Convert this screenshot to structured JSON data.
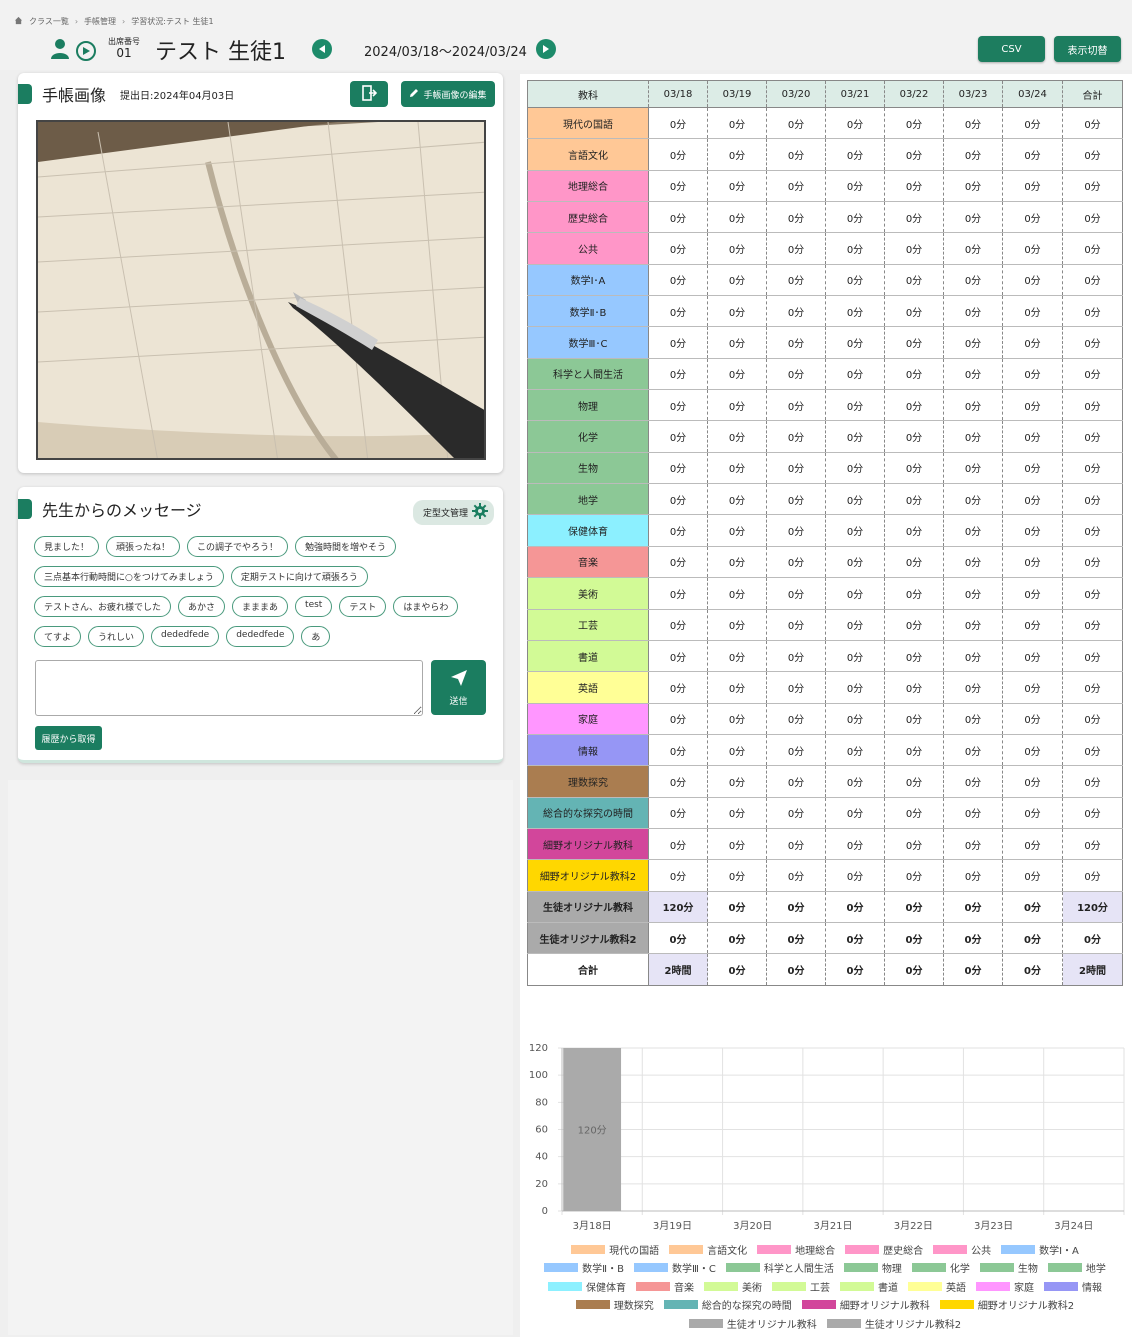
{
  "breadcrumb": [
    "クラス一覧",
    "手帳管理",
    "学習状況:テスト 生徒1"
  ],
  "header": {
    "seat_label": "出席番号",
    "seat_number": "01",
    "student_name": "テスト 生徒1",
    "date_range": "2024/03/18〜2024/03/24",
    "csv_label": "CSV",
    "toggle_label": "表示切替"
  },
  "notebook": {
    "title": "手帳画像",
    "submit_date": "提出日:2024年04月03日",
    "edit_label": "手帳画像の編集"
  },
  "message": {
    "title": "先生からのメッセージ",
    "template_label": "定型文管理",
    "chips": [
      [
        "見ました！",
        "頑張ったね！",
        "この調子でやろう！",
        "勉強時間を増やそう"
      ],
      [
        "三点基本行動時間に○をつけてみましょう",
        "定期テストに向けて頑張ろう"
      ],
      [
        "テストさん、お疲れ様でした",
        "あかさ",
        "まままあ",
        "test",
        "テスト",
        "はまやらわ"
      ],
      [
        "てすよ",
        "うれしい",
        "dededfede",
        "dededfede",
        "あ"
      ]
    ],
    "textarea_value": "",
    "send_label": "送信",
    "history_label": "履歴から取得"
  },
  "table": {
    "headers": [
      "教科",
      "03/18",
      "03/19",
      "03/20",
      "03/21",
      "03/22",
      "03/23",
      "03/24",
      "合計"
    ],
    "rows": [
      {
        "subject": "現代の国語",
        "color": "#ffc896",
        "values": [
          "0分",
          "0分",
          "0分",
          "0分",
          "0分",
          "0分",
          "0分",
          "0分"
        ]
      },
      {
        "subject": "言語文化",
        "color": "#ffc896",
        "values": [
          "0分",
          "0分",
          "0分",
          "0分",
          "0分",
          "0分",
          "0分",
          "0分"
        ]
      },
      {
        "subject": "地理総合",
        "color": "#ff96c8",
        "values": [
          "0分",
          "0分",
          "0分",
          "0分",
          "0分",
          "0分",
          "0分",
          "0分"
        ]
      },
      {
        "subject": "歴史総合",
        "color": "#ff96c8",
        "values": [
          "0分",
          "0分",
          "0分",
          "0分",
          "0分",
          "0分",
          "0分",
          "0分"
        ]
      },
      {
        "subject": "公共",
        "color": "#ff96c8",
        "values": [
          "0分",
          "0分",
          "0分",
          "0分",
          "0分",
          "0分",
          "0分",
          "0分"
        ]
      },
      {
        "subject": "数学Ⅰ･A",
        "color": "#96c8ff",
        "values": [
          "0分",
          "0分",
          "0分",
          "0分",
          "0分",
          "0分",
          "0分",
          "0分"
        ]
      },
      {
        "subject": "数学Ⅱ･B",
        "color": "#96c8ff",
        "values": [
          "0分",
          "0分",
          "0分",
          "0分",
          "0分",
          "0分",
          "0分",
          "0分"
        ]
      },
      {
        "subject": "数学Ⅲ･C",
        "color": "#96c8ff",
        "values": [
          "0分",
          "0分",
          "0分",
          "0分",
          "0分",
          "0分",
          "0分",
          "0分"
        ]
      },
      {
        "subject": "科学と人間生活",
        "color": "#8cc896",
        "values": [
          "0分",
          "0分",
          "0分",
          "0分",
          "0分",
          "0分",
          "0分",
          "0分"
        ]
      },
      {
        "subject": "物理",
        "color": "#8cc896",
        "values": [
          "0分",
          "0分",
          "0分",
          "0分",
          "0分",
          "0分",
          "0分",
          "0分"
        ]
      },
      {
        "subject": "化学",
        "color": "#8cc896",
        "values": [
          "0分",
          "0分",
          "0分",
          "0分",
          "0分",
          "0分",
          "0分",
          "0分"
        ]
      },
      {
        "subject": "生物",
        "color": "#8cc896",
        "values": [
          "0分",
          "0分",
          "0分",
          "0分",
          "0分",
          "0分",
          "0分",
          "0分"
        ]
      },
      {
        "subject": "地学",
        "color": "#8cc896",
        "values": [
          "0分",
          "0分",
          "0分",
          "0分",
          "0分",
          "0分",
          "0分",
          "0分"
        ]
      },
      {
        "subject": "保健体育",
        "color": "#8cf0ff",
        "values": [
          "0分",
          "0分",
          "0分",
          "0分",
          "0分",
          "0分",
          "0分",
          "0分"
        ]
      },
      {
        "subject": "音楽",
        "color": "#f59696",
        "values": [
          "0分",
          "0分",
          "0分",
          "0分",
          "0分",
          "0分",
          "0分",
          "0分"
        ]
      },
      {
        "subject": "美術",
        "color": "#d2fa96",
        "values": [
          "0分",
          "0分",
          "0分",
          "0分",
          "0分",
          "0分",
          "0分",
          "0分"
        ]
      },
      {
        "subject": "工芸",
        "color": "#d2fa96",
        "values": [
          "0分",
          "0分",
          "0分",
          "0分",
          "0分",
          "0分",
          "0分",
          "0分"
        ]
      },
      {
        "subject": "書道",
        "color": "#d2fa96",
        "values": [
          "0分",
          "0分",
          "0分",
          "0分",
          "0分",
          "0分",
          "0分",
          "0分"
        ]
      },
      {
        "subject": "英語",
        "color": "#ffff96",
        "values": [
          "0分",
          "0分",
          "0分",
          "0分",
          "0分",
          "0分",
          "0分",
          "0分"
        ]
      },
      {
        "subject": "家庭",
        "color": "#ff96ff",
        "values": [
          "0分",
          "0分",
          "0分",
          "0分",
          "0分",
          "0分",
          "0分",
          "0分"
        ]
      },
      {
        "subject": "情報",
        "color": "#9696f5",
        "values": [
          "0分",
          "0分",
          "0分",
          "0分",
          "0分",
          "0分",
          "0分",
          "0分"
        ]
      },
      {
        "subject": "理数探究",
        "color": "#aa7d50",
        "values": [
          "0分",
          "0分",
          "0分",
          "0分",
          "0分",
          "0分",
          "0分",
          "0分"
        ]
      },
      {
        "subject": "総合的な探究の時間",
        "color": "#64b4b4",
        "values": [
          "0分",
          "0分",
          "0分",
          "0分",
          "0分",
          "0分",
          "0分",
          "0分"
        ]
      },
      {
        "subject": "細野オリジナル教科",
        "color": "#d2469b",
        "values": [
          "0分",
          "0分",
          "0分",
          "0分",
          "0分",
          "0分",
          "0分",
          "0分"
        ]
      },
      {
        "subject": "細野オリジナル教科2",
        "color": "#ffd700",
        "values": [
          "0分",
          "0分",
          "0分",
          "0分",
          "0分",
          "0分",
          "0分",
          "0分"
        ]
      },
      {
        "subject": "生徒オリジナル教科",
        "color": "#aaaaaa",
        "bold": true,
        "values": [
          "120分",
          "0分",
          "0分",
          "0分",
          "0分",
          "0分",
          "0分",
          "120分"
        ]
      },
      {
        "subject": "生徒オリジナル教科2",
        "color": "#aaaaaa",
        "bold": true,
        "values": [
          "0分",
          "0分",
          "0分",
          "0分",
          "0分",
          "0分",
          "0分",
          "0分"
        ]
      },
      {
        "subject": "合計",
        "color": "#ffffff",
        "bold": true,
        "values": [
          "2時間",
          "0分",
          "0分",
          "0分",
          "0分",
          "0分",
          "0分",
          "2時間"
        ]
      }
    ]
  },
  "chart_data": {
    "type": "bar",
    "categories": [
      "3月18日",
      "3月19日",
      "3月20日",
      "3月21日",
      "3月22日",
      "3月23日",
      "3月24日"
    ],
    "ylim": [
      0,
      120
    ],
    "yticks": [
      0,
      20,
      40,
      60,
      80,
      100,
      120
    ],
    "stacked": true,
    "series": [
      {
        "name": "生徒オリジナル教科",
        "color": "#aaaaaa",
        "values": [
          120,
          0,
          0,
          0,
          0,
          0,
          0
        ]
      }
    ],
    "bar_labels": [
      "120分",
      "",
      "",
      "",
      "",
      "",
      ""
    ],
    "legend_position": "bottom",
    "legend": [
      [
        [
          "現代の国語",
          "#ffc896"
        ],
        [
          "言語文化",
          "#ffc896"
        ],
        [
          "地理総合",
          "#ff96c8"
        ],
        [
          "歴史総合",
          "#ff96c8"
        ],
        [
          "公共",
          "#ff96c8"
        ],
        [
          "数学Ⅰ・A",
          "#96c8ff"
        ]
      ],
      [
        [
          "数学Ⅱ・B",
          "#96c8ff"
        ],
        [
          "数学Ⅲ・C",
          "#96c8ff"
        ],
        [
          "科学と人間生活",
          "#8cc896"
        ],
        [
          "物理",
          "#8cc896"
        ],
        [
          "化学",
          "#8cc896"
        ],
        [
          "生物",
          "#8cc896"
        ],
        [
          "地学",
          "#8cc896"
        ]
      ],
      [
        [
          "保健体育",
          "#8cf0ff"
        ],
        [
          "音楽",
          "#f59696"
        ],
        [
          "美術",
          "#d2fa96"
        ],
        [
          "工芸",
          "#d2fa96"
        ],
        [
          "書道",
          "#d2fa96"
        ],
        [
          "英語",
          "#ffff96"
        ],
        [
          "家庭",
          "#ff96ff"
        ],
        [
          "情報",
          "#9696f5"
        ]
      ],
      [
        [
          "理数探究",
          "#aa7d50"
        ],
        [
          "総合的な探究の時間",
          "#64b4b4"
        ],
        [
          "細野オリジナル教科",
          "#d2469b"
        ],
        [
          "細野オリジナル教科2",
          "#ffd700"
        ]
      ],
      [
        [
          "生徒オリジナル教科",
          "#aaaaaa"
        ],
        [
          "生徒オリジナル教科2",
          "#aaaaaa"
        ]
      ]
    ]
  }
}
